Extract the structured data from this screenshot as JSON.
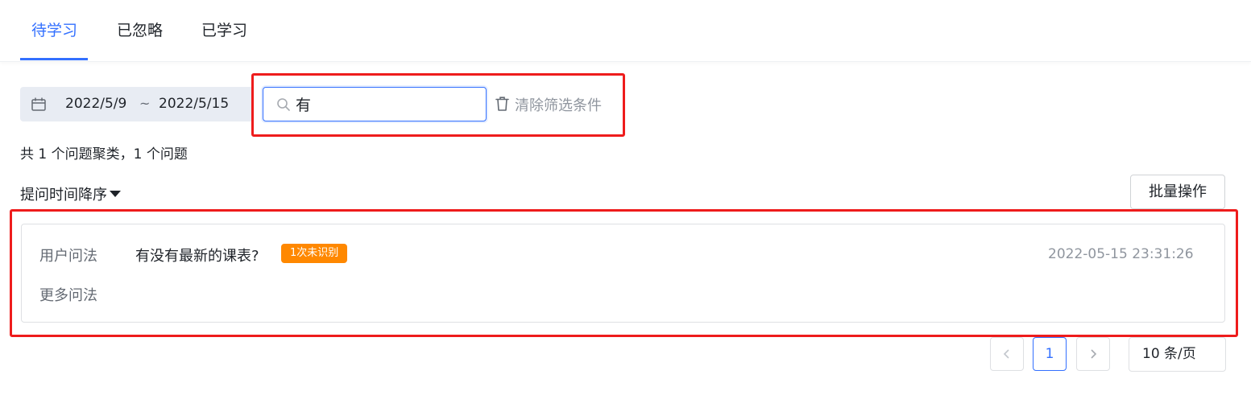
{
  "tabs": [
    {
      "label": "待学习",
      "active": true
    },
    {
      "label": "已忽略",
      "active": false
    },
    {
      "label": "已学习",
      "active": false
    }
  ],
  "filters": {
    "date_start": "2022/5/9",
    "date_separator": "~",
    "date_end": "2022/5/15",
    "search_value": "有",
    "clear_label": "清除筛选条件"
  },
  "summary": "共 1 个问题聚类，1 个问题",
  "sort_label": "提问时间降序",
  "batch_label": "批量操作",
  "cluster": {
    "user_question_label": "用户问法",
    "question_text": "有没有最新的课表?",
    "badge": "1次未识别",
    "timestamp": "2022-05-15 23:31:26",
    "more_label": "更多问法"
  },
  "pagination": {
    "prev": "<",
    "current_page": "1",
    "next": ">",
    "page_size": "10 条/页"
  },
  "colors": {
    "accent": "#3370ff",
    "badge": "#ff8800",
    "annotation": "#ee1c1c"
  },
  "icons": [
    "calendar-icon",
    "search-icon",
    "trash-icon",
    "sort-caret-icon",
    "chevron-left-icon",
    "chevron-right-icon"
  ]
}
